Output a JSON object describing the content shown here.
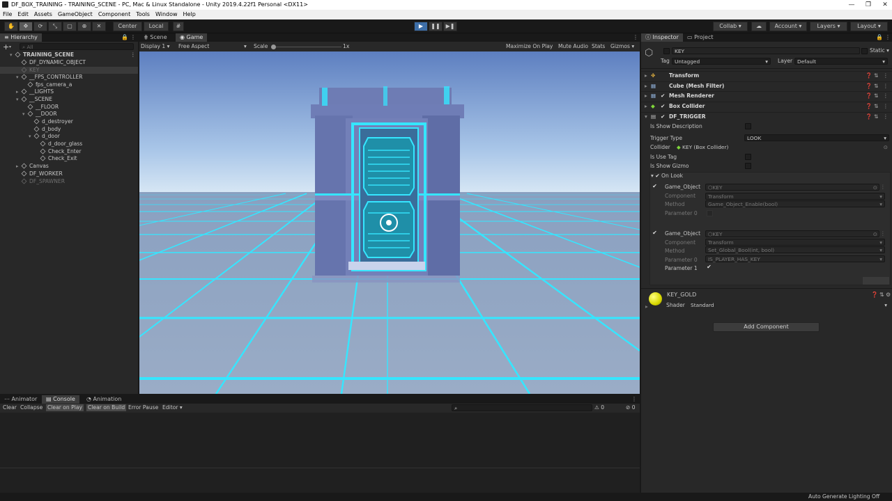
{
  "window": {
    "title": "DF_BOX_TRAINING - TRAINING_SCENE - PC, Mac & Linux Standalone - Unity 2019.4.22f1 Personal <DX11>"
  },
  "menu": [
    "File",
    "Edit",
    "Assets",
    "GameObject",
    "Component",
    "Tools",
    "Window",
    "Help"
  ],
  "toolbar": {
    "pivot": "Center",
    "space": "Local",
    "collab": "Collab",
    "account": "Account",
    "layers": "Layers",
    "layout": "Layout"
  },
  "hierarchy": {
    "tab": "Hierarchy",
    "search_placeholder": "All",
    "items": [
      {
        "label": "TRAINING_SCENE",
        "depth": 0,
        "dim": false,
        "bold": true
      },
      {
        "label": "DF_DYNAMIC_OBJECT",
        "depth": 1,
        "dim": false
      },
      {
        "label": "KEY",
        "depth": 1,
        "dim": true,
        "selected": true
      },
      {
        "label": "__FPS_CONTROLLER",
        "depth": 1,
        "dim": false
      },
      {
        "label": "fps_camera_a",
        "depth": 2,
        "dim": false
      },
      {
        "label": "__LIGHTS",
        "depth": 1,
        "dim": false
      },
      {
        "label": "__SCENE",
        "depth": 1,
        "dim": false
      },
      {
        "label": "__FLOOR",
        "depth": 2,
        "dim": false
      },
      {
        "label": "__DOOR",
        "depth": 2,
        "dim": false
      },
      {
        "label": "d_destroyer",
        "depth": 3,
        "dim": false
      },
      {
        "label": "d_body",
        "depth": 3,
        "dim": false
      },
      {
        "label": "d_door",
        "depth": 3,
        "dim": false
      },
      {
        "label": "d_door_glass",
        "depth": 4,
        "dim": false
      },
      {
        "label": "Check_Enter",
        "depth": 4,
        "dim": false
      },
      {
        "label": "Check_Exit",
        "depth": 4,
        "dim": false
      },
      {
        "label": "Canvas",
        "depth": 1,
        "dim": false
      },
      {
        "label": "DF_WORKER",
        "depth": 1,
        "dim": false
      },
      {
        "label": "DF_SPAWNER",
        "depth": 1,
        "dim": true
      }
    ]
  },
  "game": {
    "tabs": [
      "Scene",
      "Game"
    ],
    "display": "Display 1",
    "aspect": "Free Aspect",
    "scale_label": "Scale",
    "scale_value": "1x",
    "maximize": "Maximize On Play",
    "mute": "Mute Audio",
    "stats": "Stats",
    "gizmos": "Gizmos"
  },
  "console": {
    "tabs": [
      "Animator",
      "Console",
      "Animation"
    ],
    "buttons": [
      "Clear",
      "Collapse",
      "Clear on Play",
      "Clear on Build",
      "Error Pause",
      "Editor"
    ],
    "count_warn": "0",
    "count_err": "0"
  },
  "inspector": {
    "tabs": [
      "Inspector",
      "Project"
    ],
    "object_name": "KEY",
    "static": "Static",
    "tag_label": "Tag",
    "tag_value": "Untagged",
    "layer_label": "Layer",
    "layer_value": "Default",
    "components": [
      "Transform",
      "Cube (Mesh Filter)",
      "Mesh Renderer",
      "Box Collider",
      "DF_TRIGGER"
    ],
    "trigger": {
      "is_show_description": "Is Show Description",
      "trigger_type_label": "Trigger Type",
      "trigger_type_value": "LOOK",
      "collider_label": "Collider",
      "collider_value": "KEY (Box Collider)",
      "is_use_tag": "Is Use Tag",
      "is_show_gizmo": "Is Show Gizmo",
      "on_look": "On Look",
      "event1": {
        "go_label": "Game_Object",
        "go_value": "KEY",
        "comp_label": "Component",
        "comp_value": "Transform",
        "method_label": "Method",
        "method_value": "Game_Object_Enable(bool)",
        "p0_label": "Parameter 0"
      },
      "event2": {
        "go_label": "Game_Object",
        "go_value": "KEY",
        "comp_label": "Component",
        "comp_value": "Transform",
        "method_label": "Method",
        "method_value": "Set_Global_Bool(int, bool)",
        "p0_label": "Parameter 0",
        "p0_value": "IS_PLAYER_HAS_KEY",
        "p1_label": "Parameter 1"
      }
    },
    "material": {
      "name": "KEY_GOLD",
      "shader_label": "Shader",
      "shader_value": "Standard"
    },
    "add_component": "Add Component"
  },
  "statusbar": {
    "right": "Auto Generate Lighting Off"
  },
  "colors": {
    "accent": "#3d6ea8",
    "neon": "#35e6ff",
    "sky_top": "#5d7fc0",
    "floor": "#93a7c4"
  }
}
